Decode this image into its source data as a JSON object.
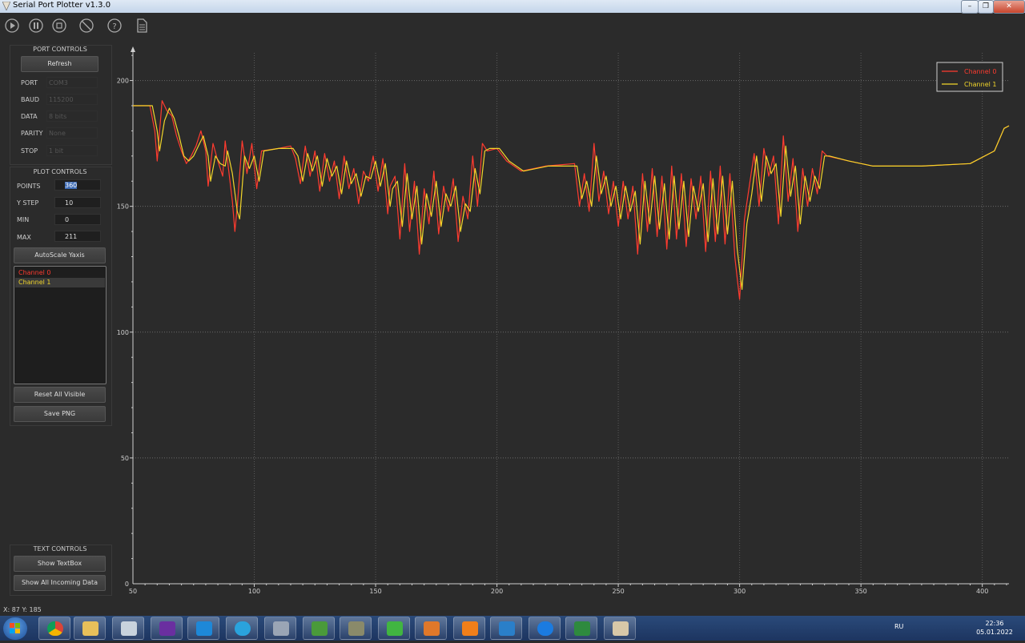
{
  "window": {
    "title": "Serial Port Plotter v1.3.0"
  },
  "toolbar": {
    "icons": [
      "play-icon",
      "pause-icon",
      "stop-icon",
      "clear-icon",
      "help-icon",
      "document-icon"
    ]
  },
  "port_controls": {
    "title": "PORT CONTROLS",
    "refresh_label": "Refresh",
    "fields": [
      {
        "label": "PORT",
        "value": "COM3"
      },
      {
        "label": "BAUD",
        "value": "115200"
      },
      {
        "label": "DATA",
        "value": "8 bits"
      },
      {
        "label": "PARITY",
        "value": "None"
      },
      {
        "label": "STOP",
        "value": "1 bit"
      }
    ]
  },
  "plot_controls": {
    "title": "PLOT CONTROLS",
    "points_label": "POINTS",
    "points_value": "360",
    "ystep_label": "Y STEP",
    "ystep_value": "10",
    "min_label": "MIN",
    "min_value": "0",
    "max_label": "MAX",
    "max_value": "211",
    "autoscale_label": "AutoScale Yaxis",
    "channels": [
      "Channel 0",
      "Channel 1"
    ],
    "reset_label": "Reset All Visible",
    "save_label": "Save PNG"
  },
  "text_controls": {
    "title": "TEXT CONTROLS",
    "show_textbox_label": "Show TextBox",
    "show_all_label": "Show All Incoming Data"
  },
  "status": {
    "text": "X: 87 Y: 185"
  },
  "colors": {
    "channel0": "#ff3b2f",
    "channel1": "#f2d62a",
    "background": "#2b2b2b"
  },
  "chart_data": {
    "type": "line",
    "xlim": [
      50,
      411
    ],
    "ylim": [
      0,
      211
    ],
    "xticks": [
      50,
      100,
      150,
      200,
      250,
      300,
      350,
      400
    ],
    "yticks": [
      0,
      50,
      100,
      150,
      200
    ],
    "grid": true,
    "legend_placement": "top-right",
    "series": [
      {
        "name": "Channel 0",
        "color": "#ff3b2f",
        "points": [
          [
            50,
            190
          ],
          [
            57,
            190
          ],
          [
            59,
            180
          ],
          [
            60,
            168
          ],
          [
            62,
            192
          ],
          [
            64,
            188
          ],
          [
            66,
            186
          ],
          [
            68,
            178
          ],
          [
            70,
            172
          ],
          [
            72,
            167
          ],
          [
            74,
            170
          ],
          [
            76,
            174
          ],
          [
            78,
            180
          ],
          [
            80,
            172
          ],
          [
            81,
            158
          ],
          [
            83,
            175
          ],
          [
            85,
            168
          ],
          [
            87,
            162
          ],
          [
            88,
            176
          ],
          [
            90,
            160
          ],
          [
            91,
            152
          ],
          [
            92,
            140
          ],
          [
            93,
            150
          ],
          [
            95,
            176
          ],
          [
            97,
            163
          ],
          [
            99,
            175
          ],
          [
            101,
            157
          ],
          [
            103,
            172
          ],
          [
            110,
            173
          ],
          [
            115,
            174
          ],
          [
            117,
            169
          ],
          [
            119,
            159
          ],
          [
            121,
            174
          ],
          [
            123,
            162
          ],
          [
            125,
            172
          ],
          [
            127,
            156
          ],
          [
            129,
            171
          ],
          [
            131,
            160
          ],
          [
            133,
            168
          ],
          [
            135,
            153
          ],
          [
            137,
            170
          ],
          [
            139,
            157
          ],
          [
            141,
            165
          ],
          [
            143,
            151
          ],
          [
            145,
            164
          ],
          [
            147,
            160
          ],
          [
            149,
            170
          ],
          [
            151,
            156
          ],
          [
            153,
            169
          ],
          [
            155,
            147
          ],
          [
            156,
            158
          ],
          [
            158,
            162
          ],
          [
            160,
            137
          ],
          [
            162,
            167
          ],
          [
            164,
            140
          ],
          [
            166,
            160
          ],
          [
            168,
            131
          ],
          [
            170,
            157
          ],
          [
            172,
            143
          ],
          [
            174,
            164
          ],
          [
            176,
            139
          ],
          [
            178,
            158
          ],
          [
            180,
            148
          ],
          [
            182,
            161
          ],
          [
            184,
            136
          ],
          [
            186,
            154
          ],
          [
            188,
            145
          ],
          [
            190,
            170
          ],
          [
            192,
            150
          ],
          [
            194,
            175
          ],
          [
            196,
            172
          ],
          [
            200,
            173
          ],
          [
            204,
            168
          ],
          [
            210,
            164
          ],
          [
            220,
            166
          ],
          [
            232,
            167
          ],
          [
            234,
            150
          ],
          [
            236,
            163
          ],
          [
            238,
            148
          ],
          [
            240,
            175
          ],
          [
            242,
            152
          ],
          [
            244,
            164
          ],
          [
            246,
            147
          ],
          [
            248,
            160
          ],
          [
            250,
            142
          ],
          [
            252,
            160
          ],
          [
            254,
            145
          ],
          [
            256,
            158
          ],
          [
            258,
            131
          ],
          [
            260,
            163
          ],
          [
            262,
            140
          ],
          [
            264,
            165
          ],
          [
            266,
            138
          ],
          [
            268,
            162
          ],
          [
            270,
            133
          ],
          [
            272,
            166
          ],
          [
            274,
            137
          ],
          [
            276,
            163
          ],
          [
            278,
            134
          ],
          [
            280,
            161
          ],
          [
            282,
            145
          ],
          [
            284,
            162
          ],
          [
            286,
            132
          ],
          [
            288,
            164
          ],
          [
            290,
            136
          ],
          [
            292,
            166
          ],
          [
            294,
            135
          ],
          [
            296,
            163
          ],
          [
            298,
            130
          ],
          [
            300,
            113
          ],
          [
            302,
            145
          ],
          [
            304,
            158
          ],
          [
            306,
            171
          ],
          [
            308,
            150
          ],
          [
            310,
            173
          ],
          [
            312,
            162
          ],
          [
            314,
            170
          ],
          [
            316,
            143
          ],
          [
            318,
            178
          ],
          [
            320,
            152
          ],
          [
            322,
            169
          ],
          [
            324,
            140
          ],
          [
            326,
            165
          ],
          [
            328,
            150
          ],
          [
            330,
            165
          ],
          [
            332,
            155
          ],
          [
            334,
            172
          ],
          [
            336,
            170
          ],
          [
            345,
            168
          ],
          [
            355,
            166
          ],
          [
            375,
            166
          ],
          [
            395,
            167
          ],
          [
            405,
            172
          ],
          [
            409,
            181
          ],
          [
            411,
            182
          ]
        ]
      },
      {
        "name": "Channel 1",
        "color": "#f2d62a",
        "points": [
          [
            50,
            190
          ],
          [
            58,
            190
          ],
          [
            60,
            180
          ],
          [
            61,
            172
          ],
          [
            63,
            184
          ],
          [
            65,
            189
          ],
          [
            67,
            185
          ],
          [
            69,
            178
          ],
          [
            71,
            170
          ],
          [
            73,
            168
          ],
          [
            75,
            170
          ],
          [
            77,
            174
          ],
          [
            79,
            178
          ],
          [
            81,
            170
          ],
          [
            82,
            160
          ],
          [
            84,
            170
          ],
          [
            86,
            167
          ],
          [
            88,
            166
          ],
          [
            89,
            172
          ],
          [
            91,
            163
          ],
          [
            93,
            148
          ],
          [
            94,
            145
          ],
          [
            96,
            170
          ],
          [
            98,
            165
          ],
          [
            100,
            170
          ],
          [
            102,
            160
          ],
          [
            104,
            172
          ],
          [
            110,
            173
          ],
          [
            116,
            173
          ],
          [
            118,
            170
          ],
          [
            120,
            160
          ],
          [
            122,
            171
          ],
          [
            124,
            164
          ],
          [
            126,
            170
          ],
          [
            128,
            158
          ],
          [
            130,
            169
          ],
          [
            132,
            162
          ],
          [
            134,
            166
          ],
          [
            136,
            155
          ],
          [
            138,
            168
          ],
          [
            140,
            159
          ],
          [
            142,
            163
          ],
          [
            144,
            154
          ],
          [
            146,
            162
          ],
          [
            148,
            161
          ],
          [
            150,
            168
          ],
          [
            152,
            158
          ],
          [
            154,
            167
          ],
          [
            156,
            150
          ],
          [
            157,
            157
          ],
          [
            159,
            160
          ],
          [
            161,
            142
          ],
          [
            163,
            163
          ],
          [
            165,
            145
          ],
          [
            167,
            158
          ],
          [
            169,
            135
          ],
          [
            171,
            155
          ],
          [
            173,
            146
          ],
          [
            175,
            160
          ],
          [
            177,
            142
          ],
          [
            179,
            155
          ],
          [
            181,
            150
          ],
          [
            183,
            158
          ],
          [
            185,
            140
          ],
          [
            187,
            151
          ],
          [
            189,
            148
          ],
          [
            191,
            165
          ],
          [
            193,
            155
          ],
          [
            195,
            172
          ],
          [
            197,
            173
          ],
          [
            201,
            173
          ],
          [
            205,
            168
          ],
          [
            211,
            164
          ],
          [
            221,
            166
          ],
          [
            233,
            166
          ],
          [
            235,
            153
          ],
          [
            237,
            160
          ],
          [
            239,
            150
          ],
          [
            241,
            170
          ],
          [
            243,
            155
          ],
          [
            245,
            162
          ],
          [
            247,
            150
          ],
          [
            249,
            158
          ],
          [
            251,
            145
          ],
          [
            253,
            158
          ],
          [
            255,
            148
          ],
          [
            257,
            156
          ],
          [
            259,
            135
          ],
          [
            261,
            160
          ],
          [
            263,
            143
          ],
          [
            265,
            162
          ],
          [
            267,
            141
          ],
          [
            269,
            159
          ],
          [
            271,
            137
          ],
          [
            273,
            162
          ],
          [
            275,
            141
          ],
          [
            277,
            160
          ],
          [
            279,
            138
          ],
          [
            281,
            158
          ],
          [
            283,
            148
          ],
          [
            285,
            159
          ],
          [
            287,
            136
          ],
          [
            289,
            161
          ],
          [
            291,
            139
          ],
          [
            293,
            162
          ],
          [
            295,
            139
          ],
          [
            297,
            160
          ],
          [
            299,
            133
          ],
          [
            301,
            117
          ],
          [
            303,
            143
          ],
          [
            305,
            155
          ],
          [
            307,
            170
          ],
          [
            309,
            152
          ],
          [
            311,
            170
          ],
          [
            313,
            163
          ],
          [
            315,
            167
          ],
          [
            317,
            146
          ],
          [
            319,
            174
          ],
          [
            321,
            154
          ],
          [
            323,
            166
          ],
          [
            325,
            143
          ],
          [
            327,
            162
          ],
          [
            329,
            152
          ],
          [
            331,
            162
          ],
          [
            333,
            157
          ],
          [
            335,
            170
          ],
          [
            337,
            170
          ],
          [
            345,
            168
          ],
          [
            355,
            166
          ],
          [
            375,
            166
          ],
          [
            395,
            167
          ],
          [
            405,
            172
          ],
          [
            409,
            181
          ],
          [
            411,
            182
          ]
        ]
      }
    ]
  }
}
